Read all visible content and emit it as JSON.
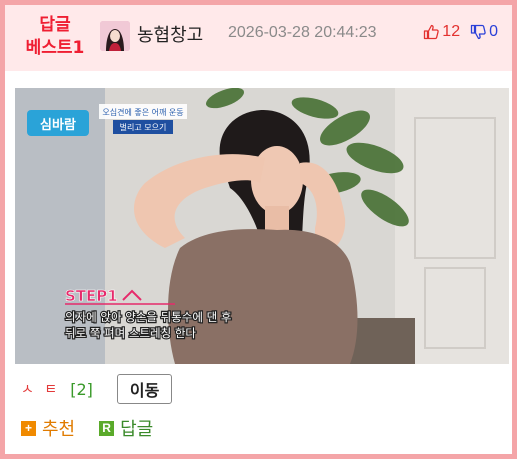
{
  "colors": {
    "frame": "#f4a5a8",
    "header_bg": "#ffe9ea",
    "best_text": "#ef1e32",
    "upvote": "#e3312f",
    "downvote": "#2a40d8",
    "recommend": "#f08a00",
    "reply": "#5aaa2a"
  },
  "post": {
    "badge_line1": "답글",
    "badge_line2": "베스트1",
    "author": "농협창고",
    "datetime": "2026-03-28 20:44:23",
    "upvotes": "12",
    "downvotes": "0"
  },
  "image": {
    "show_logo": "심바람",
    "caption_top_line1": "오십견에 좋은 어깨 운동",
    "caption_top_line2": "벌리고 모으기",
    "step_label": "STEP1",
    "step_text_line1": "의자에 앉아 양손을 뒤통수에 댄 후",
    "step_text_line2": "뒤로 쭉 펴며 스트레칭 한다"
  },
  "meta": {
    "source_label": "ㅅ ㅌ",
    "comment_count": "[2]",
    "move_button": "이동"
  },
  "actions": {
    "recommend_icon": "+",
    "recommend_label": "추천",
    "reply_icon": "R",
    "reply_label": "답글"
  },
  "icons": {
    "upvote": "thumbs-up-icon",
    "downvote": "thumbs-down-icon"
  }
}
